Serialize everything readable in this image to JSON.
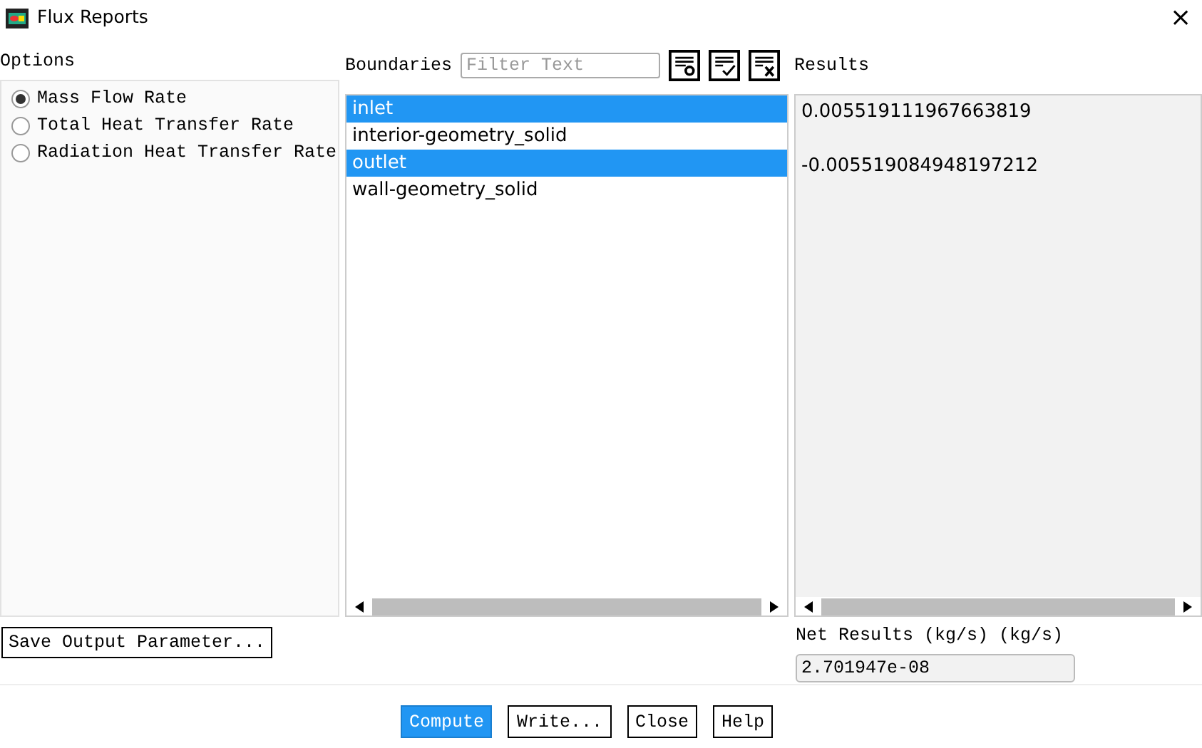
{
  "window": {
    "title": "Flux Reports",
    "close": "×"
  },
  "options": {
    "label": "Options",
    "items": [
      {
        "label": "Mass Flow Rate",
        "selected": true
      },
      {
        "label": "Total Heat Transfer Rate",
        "selected": false
      },
      {
        "label": "Radiation Heat Transfer Rate",
        "selected": false
      }
    ]
  },
  "boundaries": {
    "label": "Boundaries",
    "filter": {
      "placeholder": "Filter Text"
    },
    "items": [
      {
        "name": "inlet",
        "selected": true,
        "result": "0.005519111967663819"
      },
      {
        "name": "interior-geometry_solid",
        "selected": false
      },
      {
        "name": "outlet",
        "selected": true,
        "result": "-0.005519084948197212"
      },
      {
        "name": "wall-geometry_solid",
        "selected": false
      }
    ]
  },
  "results": {
    "label": "Results"
  },
  "save_button": "Save Output Parameter...",
  "net_results": {
    "label": "Net Results (kg/s) (kg/s)",
    "value": "2.701947e-08"
  },
  "buttons": [
    {
      "label": "Compute",
      "primary": true
    },
    {
      "label": "Write...",
      "primary": false
    },
    {
      "label": "Close",
      "primary": false
    },
    {
      "label": "Help",
      "primary": false
    }
  ]
}
